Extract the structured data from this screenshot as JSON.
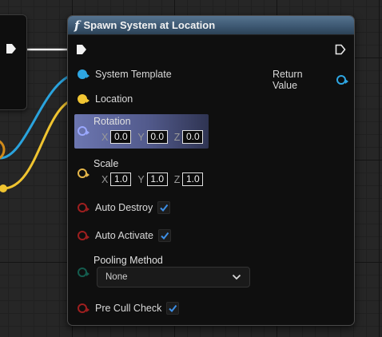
{
  "node": {
    "title": "Spawn System at Location",
    "function_icon": "f",
    "inputs": {
      "system_template": "System Template",
      "location": "Location",
      "rotation": {
        "label": "Rotation",
        "x_axis": "X",
        "y_axis": "Y",
        "z_axis": "Z",
        "x": "0.0",
        "y": "0.0",
        "z": "0.0"
      },
      "scale": {
        "label": "Scale",
        "x_axis": "X",
        "y_axis": "Y",
        "z_axis": "Z",
        "x": "1.0",
        "y": "1.0",
        "z": "1.0"
      },
      "auto_destroy": {
        "label": "Auto Destroy",
        "checked": true
      },
      "auto_activate": {
        "label": "Auto Activate",
        "checked": true
      },
      "pooling_method": {
        "label": "Pooling Method",
        "value": "None"
      },
      "pre_cull_check": {
        "label": "Pre Cull Check",
        "checked": true
      }
    },
    "outputs": {
      "return_value": "Return Value"
    }
  },
  "colors": {
    "object_pin": "#2ea6e2",
    "vector_pin": "#f2c633",
    "rotator_pin": "#9aa8ff",
    "bool_pin": "#9e1f1f",
    "enum_pin": "#145c4e",
    "checkbox_accent": "#3d8fe6",
    "header": "#3b5670"
  },
  "icons": [
    "function-icon",
    "exec-in-icon",
    "exec-out-icon",
    "checkbox-check-icon",
    "chevron-down-icon"
  ]
}
